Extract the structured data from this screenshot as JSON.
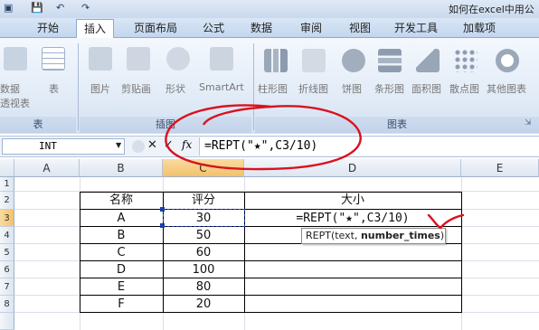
{
  "window": {
    "title": "如何在excel中用公"
  },
  "tabs": [
    "开始",
    "插入",
    "页面布局",
    "公式",
    "数据",
    "审阅",
    "视图",
    "开发工具",
    "加载项"
  ],
  "active_tab": "插入",
  "ribbon": {
    "table_group": {
      "label": "表",
      "items": [
        "数据",
        "透视表",
        "表"
      ]
    },
    "illustration_group": {
      "label": "插图",
      "items": [
        "图片",
        "剪贴画",
        "形状",
        "SmartArt"
      ]
    },
    "chart_group": {
      "label": "图表",
      "items": [
        "柱形图",
        "折线图",
        "饼图",
        "条形图",
        "面积图",
        "散点图",
        "其他图表"
      ]
    }
  },
  "formula_bar": {
    "name_box": "INT",
    "fx_label": "fx",
    "formula": "=REPT(\"★\",C3/10)"
  },
  "columns": [
    "A",
    "B",
    "C",
    "D",
    "E"
  ],
  "rows": [
    "1",
    "2",
    "3",
    "4",
    "5",
    "6",
    "7",
    "8"
  ],
  "table": {
    "headers": [
      "名称",
      "评分",
      "大小"
    ],
    "rows": [
      {
        "name": "A",
        "score": "30",
        "size": "=REPT(\"★\",C3/10)"
      },
      {
        "name": "B",
        "score": "50",
        "size": ""
      },
      {
        "name": "C",
        "score": "60",
        "size": ""
      },
      {
        "name": "D",
        "score": "100",
        "size": ""
      },
      {
        "name": "E",
        "score": "80",
        "size": ""
      },
      {
        "name": "F",
        "score": "20",
        "size": ""
      }
    ]
  },
  "tooltip": {
    "prefix": "REPT(text, ",
    "bold": "number_times",
    "suffix": ")"
  },
  "colors": {
    "annotation": "#d9121f",
    "accent": "#f3c26b"
  }
}
